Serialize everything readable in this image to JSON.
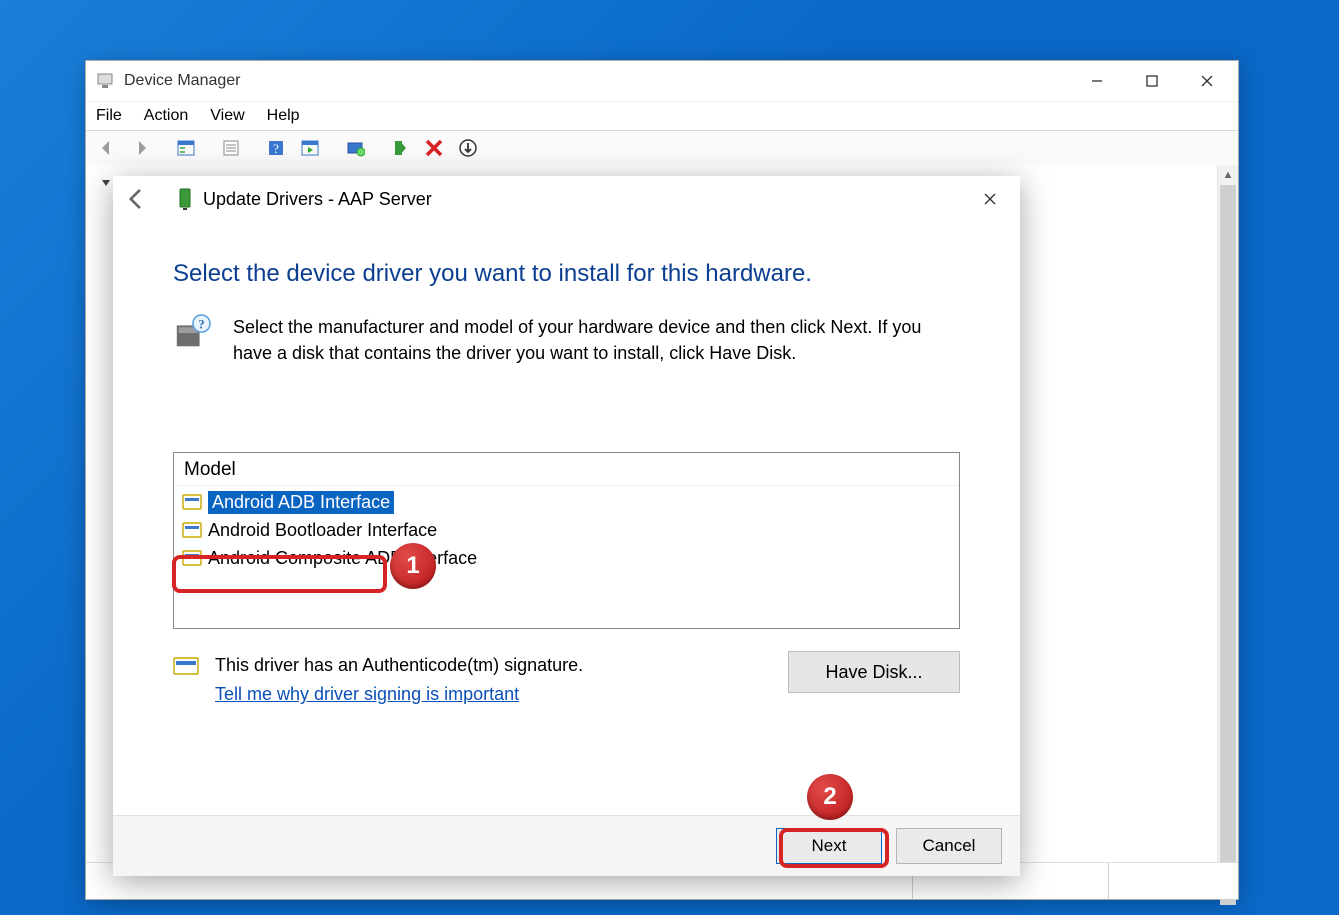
{
  "device_manager": {
    "title": "Device Manager",
    "menu": {
      "file": "File",
      "action": "Action",
      "view": "View",
      "help": "Help"
    }
  },
  "wizard": {
    "title": "Update Drivers - AAP Server",
    "heading": "Select the device driver you want to install for this hardware.",
    "instruction": "Select the manufacturer and model of your hardware device and then click Next. If you have a disk that contains the driver you want to install, click Have Disk.",
    "model_label": "Model",
    "models": [
      {
        "label": "Android ADB Interface",
        "selected": true
      },
      {
        "label": "Android Bootloader Interface",
        "selected": false
      },
      {
        "label": "Android Composite ADB Interface",
        "selected": false
      }
    ],
    "signature_text": "This driver has an Authenticode(tm) signature.",
    "signature_link": "Tell me why driver signing is important",
    "have_disk": "Have Disk...",
    "next": "Next",
    "cancel": "Cancel"
  },
  "annotations": {
    "step1": "1",
    "step2": "2"
  }
}
